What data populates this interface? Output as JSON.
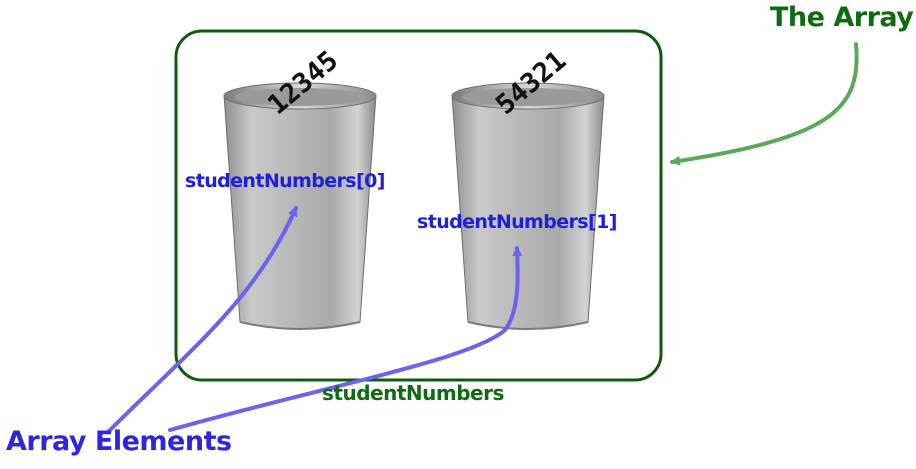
{
  "diagram": {
    "title_label": "The Array",
    "array_name": "studentNumbers",
    "elements_label": "Array Elements",
    "elements": [
      {
        "index_label": "studentNumbers[0]",
        "value": "12345"
      },
      {
        "index_label": "studentNumbers[1]",
        "value": "54321"
      }
    ],
    "colors": {
      "array_green": "#0f6b0f",
      "arrow_green": "#5aa85a",
      "element_blue": "#2020d8",
      "arrow_blue": "#6a63f0",
      "cup_metal": "#b5b5b5"
    }
  }
}
